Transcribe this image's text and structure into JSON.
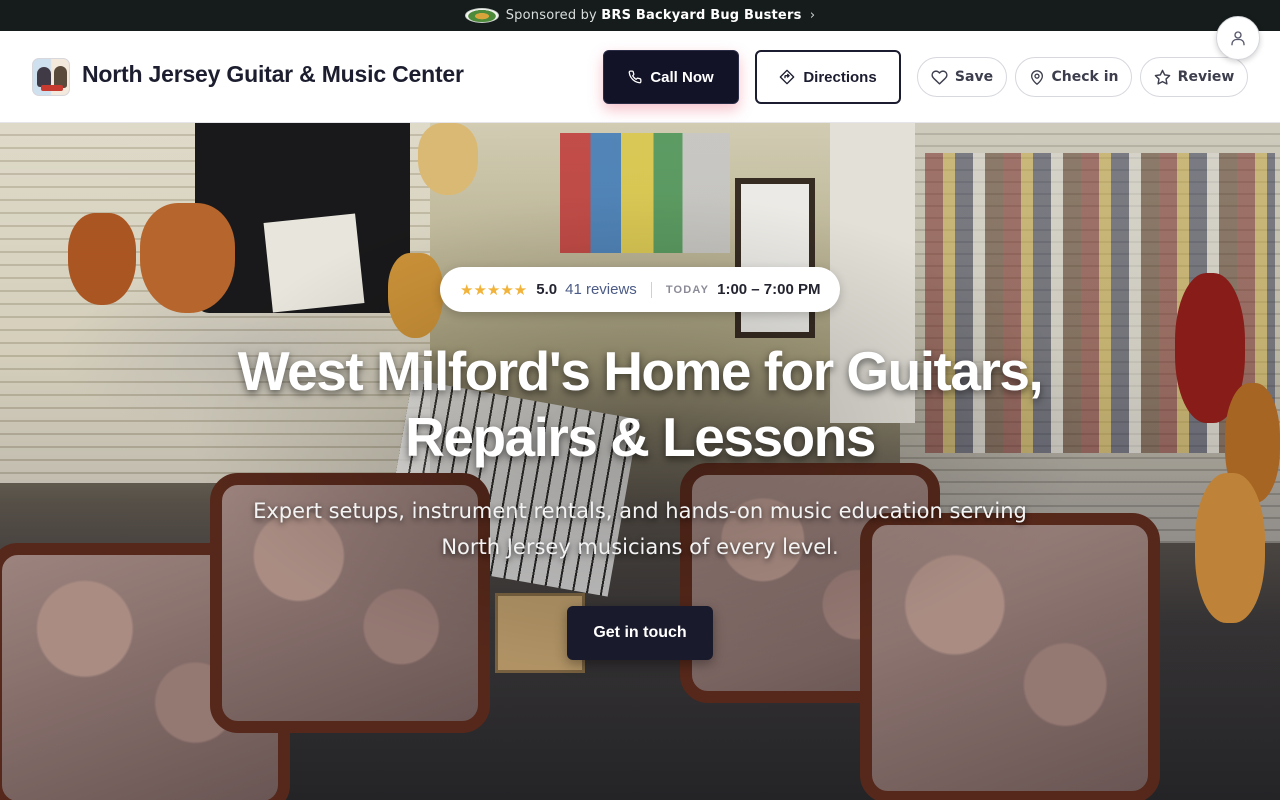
{
  "sponsor": {
    "prefix": "Sponsored by",
    "brand": "BRS Backyard Bug Busters",
    "chevron": "›",
    "logo_icon": "brs-logo-icon"
  },
  "header": {
    "business_name": "North Jersey Guitar & Music Center",
    "call_label": "Call Now",
    "directions_label": "Directions",
    "save_label": "Save",
    "checkin_label": "Check in",
    "review_label": "Review",
    "icons": {
      "call": "phone-icon",
      "directions": "directions-icon",
      "save": "heart-icon",
      "checkin": "map-pin-icon",
      "review": "star-icon",
      "account": "user-icon"
    }
  },
  "hero": {
    "stars": "★★★★★",
    "rating": "5.0",
    "reviews": "41 reviews",
    "today_label": "TODAY",
    "hours": "1:00 – 7:00 PM",
    "headline": "West Milford's Home for Guitars, Repairs & Lessons",
    "subhead": "Expert setups, instrument rentals, and hands-on music education serving North Jersey musicians of every level.",
    "cta_label": "Get in touch"
  },
  "colors": {
    "sponsor_bg": "#151c1b",
    "primary": "#121327",
    "star": "#f2b33a",
    "review_link": "#4b5b86"
  }
}
